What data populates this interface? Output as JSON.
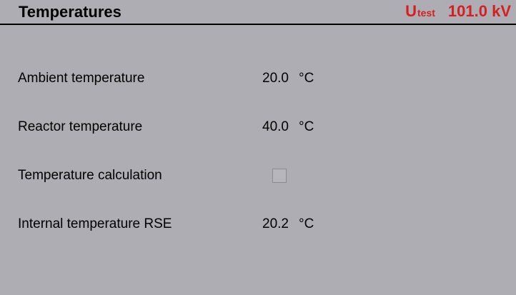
{
  "header": {
    "title": "Temperatures",
    "utest_symbol": "U",
    "utest_subscript": "test",
    "utest_value": "101.0 kV"
  },
  "rows": [
    {
      "label": "Ambient temperature",
      "value": "20.0",
      "unit": "°C"
    },
    {
      "label": "Reactor temperature",
      "value": "40.0",
      "unit": "°C"
    },
    {
      "label": "Temperature calculation",
      "checked": false
    },
    {
      "label": "Internal temperature RSE",
      "value": "20.2",
      "unit": "°C"
    }
  ],
  "colors": {
    "background": "#adadb3",
    "accent_red": "#d42020"
  }
}
